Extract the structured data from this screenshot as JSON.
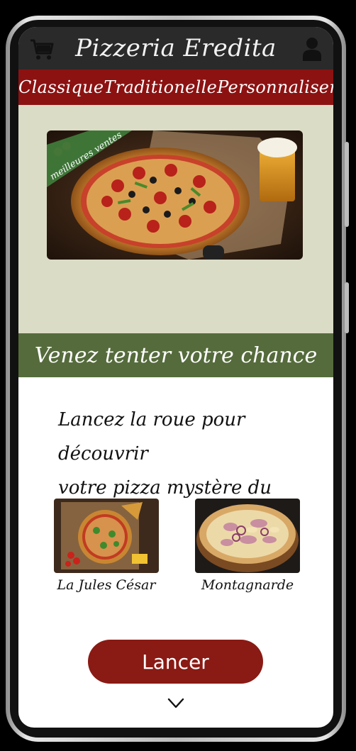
{
  "header": {
    "title": "Pizzeria Eredita",
    "cart_icon": "cart-icon",
    "user_icon": "user-icon"
  },
  "nav": {
    "tabs": [
      {
        "label": "Classique"
      },
      {
        "label": "Traditionelle"
      },
      {
        "label": "Personnaliser"
      }
    ]
  },
  "hero": {
    "ribbon": "meilleures ventes"
  },
  "promo": {
    "heading": "Venez tenter votre chance !!!",
    "line1": "Lancez la roue pour découvrir",
    "line2": "votre pizza mystère du jour !"
  },
  "cards": [
    {
      "name": "La Jules César"
    },
    {
      "name": "Montagnarde"
    }
  ],
  "cta": {
    "label": "Lancer"
  },
  "colors": {
    "header_bg": "#2a2a2a",
    "nav_bg": "#8c1212",
    "banner_bg": "#dbdcc6",
    "accent_green": "#556b3c",
    "button_bg": "#8a1a14"
  }
}
